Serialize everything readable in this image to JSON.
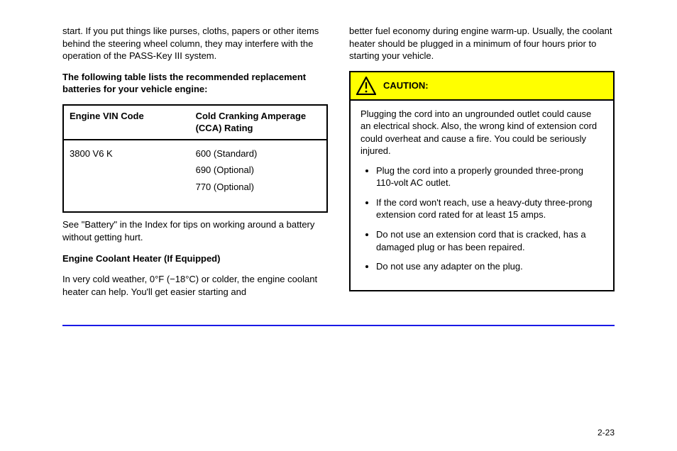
{
  "left": {
    "intro": "start. If you put things like purses, cloths, papers or other items behind the steering wheel column, they may interfere with the operation of the PASS-Key III system.",
    "index": "The following table lists the recommended replacement batteries for your vehicle engine:",
    "table": {
      "head": {
        "rating": "Engine VIN Code",
        "cca": "Cold Cranking Amperage (CCA) Rating"
      },
      "rating_value": "3800 V6 K",
      "cca_rows": [
        "600 (Standard)",
        "690 (Optional)",
        "770 (Optional)"
      ]
    },
    "battery_link": "See \"Battery\" in the Index for tips on working around a battery without getting hurt.",
    "engine_heater_heading": "Engine Coolant Heater (If Equipped)",
    "engine_heater_body": "In very cold weather, 0°F (−18°C) or colder, the engine coolant heater can help. You'll get easier starting and"
  },
  "right": {
    "top": "better fuel economy during engine warm-up. Usually, the coolant heater should be plugged in a minimum of four hours prior to starting your vehicle.",
    "caution": {
      "label": "CAUTION:",
      "lead": "Plugging the cord into an ungrounded outlet could cause an electrical shock. Also, the wrong kind of extension cord could overheat and cause a fire. You could be seriously injured.",
      "bullets": [
        "Plug the cord into a properly grounded three-prong 110-volt AC outlet.",
        "If the cord won't reach, use a heavy-duty three-prong extension cord rated for at least 15 amps.",
        "Do not use an extension cord that is cracked, has a damaged plug or has been repaired.",
        "Do not use any adapter on the plug."
      ]
    }
  },
  "page_number": "2-23"
}
